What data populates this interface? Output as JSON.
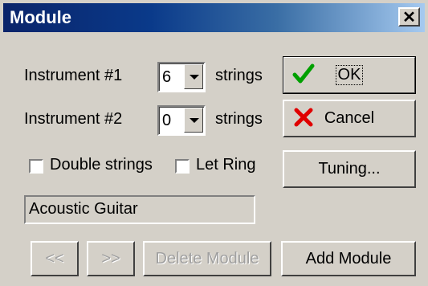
{
  "window": {
    "title": "Module",
    "close_label": "✕"
  },
  "instrument1": {
    "label": "Instrument  #1",
    "strings_value": "6",
    "strings_label": "strings"
  },
  "instrument2": {
    "label": "Instrument  #2",
    "strings_value": "0",
    "strings_label": "strings"
  },
  "buttons": {
    "ok": "OK",
    "cancel": "Cancel",
    "tuning": "Tuning...",
    "prev": "<<",
    "next": ">>",
    "delete_module": "Delete Module",
    "add_module": "Add Module"
  },
  "options": {
    "double_strings": "Double strings",
    "let_ring": "Let Ring"
  },
  "module_name": "Acoustic Guitar",
  "icons": {
    "ok": "checkmark-icon",
    "cancel": "x-icon"
  },
  "colors": {
    "title_gradient_start": "#0a246a",
    "title_gradient_end": "#a6caf0",
    "face": "#d4d0c8",
    "ok_check": "#00a000",
    "cancel_x": "#e00000"
  }
}
